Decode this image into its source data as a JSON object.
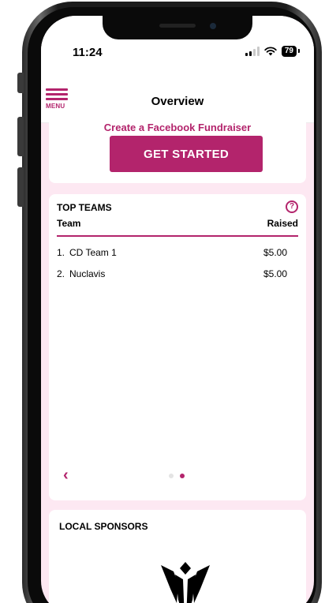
{
  "status_bar": {
    "time": "11:24",
    "battery": "79"
  },
  "nav": {
    "menu_label": "MENU",
    "title": "Overview"
  },
  "fundraiser": {
    "link_text": "Create a Facebook Fundraiser",
    "button_label": "GET STARTED"
  },
  "top_teams": {
    "title": "TOP TEAMS",
    "help_symbol": "?",
    "columns": {
      "team": "Team",
      "raised": "Raised"
    },
    "rows": [
      {
        "rank": "1.",
        "name": "CD Team 1",
        "raised": "$5.00"
      },
      {
        "rank": "2.",
        "name": "Nuclavis",
        "raised": "$5.00"
      }
    ],
    "pager": {
      "pages": 2,
      "current": 2
    }
  },
  "sponsors": {
    "title": "LOCAL SPONSORS"
  },
  "colors": {
    "accent": "#b3246c",
    "page_background": "#fde8f2",
    "card_background": "#ffffff"
  },
  "icons": {
    "menu": "hamburger-icon",
    "help": "question-circle-icon",
    "prev": "chevron-left-icon",
    "sponsor": "sponsor-logo"
  }
}
